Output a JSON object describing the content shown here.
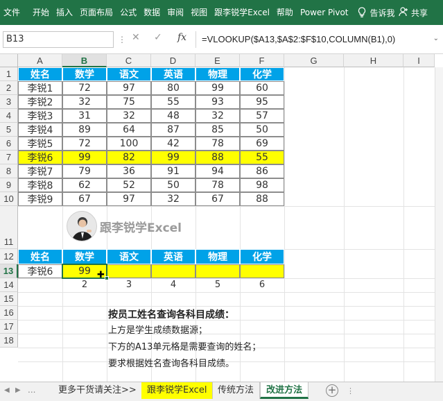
{
  "ribbon": {
    "tabs": [
      "文件",
      "开始",
      "插入",
      "页面布局",
      "公式",
      "数据",
      "审阅",
      "视图",
      "跟李锐学Excel",
      "帮助",
      "Power Pivot"
    ],
    "tell_me": "告诉我",
    "share": "共享",
    "bg_color": "#217346"
  },
  "formula_bar": {
    "name_box": "B13",
    "cancel_icon": "✕",
    "enter_icon": "✓",
    "fx_label": "fx",
    "formula": "=VLOOKUP($A13,$A$2:$F$10,COLUMN(B1),0)"
  },
  "columns": [
    "A",
    "B",
    "C",
    "D",
    "E",
    "F",
    "G",
    "H",
    "I"
  ],
  "rows": [
    "1",
    "2",
    "3",
    "4",
    "5",
    "6",
    "7",
    "8",
    "9",
    "10",
    "11",
    "12",
    "13",
    "14",
    "15",
    "16",
    "17",
    "18"
  ],
  "source_table": {
    "headers": [
      "姓名",
      "数学",
      "语文",
      "英语",
      "物理",
      "化学"
    ],
    "rows": [
      [
        "李锐1",
        "72",
        "97",
        "80",
        "99",
        "60"
      ],
      [
        "李锐2",
        "32",
        "75",
        "55",
        "93",
        "95"
      ],
      [
        "李锐3",
        "31",
        "32",
        "48",
        "32",
        "57"
      ],
      [
        "李锐4",
        "89",
        "64",
        "87",
        "85",
        "50"
      ],
      [
        "李锐5",
        "72",
        "100",
        "42",
        "78",
        "69"
      ],
      [
        "李锐6",
        "99",
        "82",
        "99",
        "88",
        "55"
      ],
      [
        "李锐7",
        "79",
        "36",
        "91",
        "94",
        "86"
      ],
      [
        "李锐8",
        "62",
        "52",
        "50",
        "78",
        "98"
      ],
      [
        "李锐9",
        "67",
        "97",
        "32",
        "67",
        "88"
      ]
    ],
    "highlight_row": 5,
    "header_color": "#00a2e8",
    "highlight_color": "#ffff00"
  },
  "logo_text": "跟李锐学Excel",
  "query_table": {
    "headers": [
      "姓名",
      "数学",
      "语文",
      "英语",
      "物理",
      "化学"
    ],
    "row": [
      "李锐6",
      "99",
      "",
      "",
      "",
      ""
    ],
    "col_index": [
      "2",
      "3",
      "4",
      "5",
      "6"
    ]
  },
  "notes": {
    "title": "按员工姓名查询各科目成绩：",
    "line1": "上方是学生成绩数据源；",
    "line2": "下方的A13单元格是需要查询的姓名；",
    "line3": "要求根据姓名查询各科目成绩。"
  },
  "sheet_tabs": {
    "nav_dots": "...",
    "tab1": "更多干货请关注>>",
    "tab2": "跟李锐学Excel",
    "tab3": "传统方法",
    "tab4": "改进方法",
    "add": "+",
    "more": "⋮"
  }
}
